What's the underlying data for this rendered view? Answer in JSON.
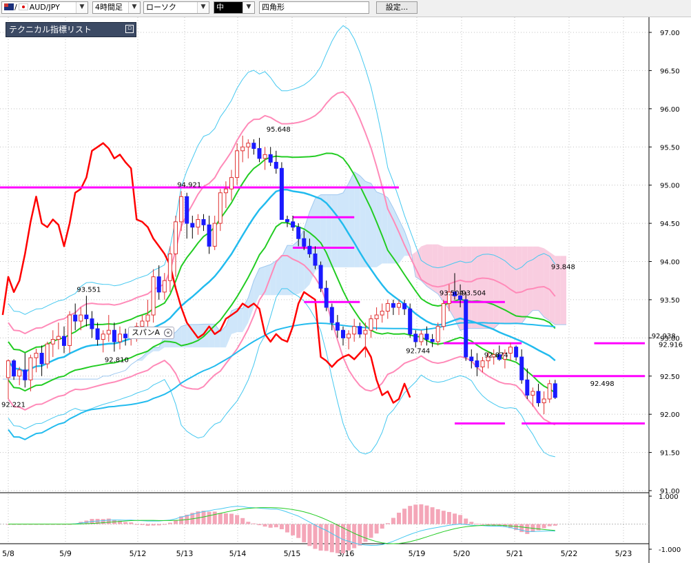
{
  "toolbar": {
    "pair": "AUD/JPY",
    "timeframe": "4時間足",
    "chart_style": "ローソク",
    "line_width": "中",
    "shape": "四角形",
    "settings_label": "設定..."
  },
  "indicator_panel": {
    "title": "テクニカル指標リスト",
    "minimize_icon": "minimize-icon"
  },
  "span_tag": {
    "label": "スパンA"
  },
  "colors": {
    "bull": "#e03030",
    "bear": "#1a1aff",
    "chikou": "#ff0000",
    "bb_mid": "#22cc22",
    "bb1": "#ff8ab8",
    "bb2": "#44c8f0",
    "ma": "#22bbee",
    "cloud_bull": "#cfe6fa",
    "cloud_bear": "#f9cde0",
    "hline": "#ff00ff"
  },
  "chart_data": {
    "type": "candlestick",
    "y_ticks": [
      "97.00",
      "96.50",
      "96.00",
      "95.50",
      "95.00",
      "94.50",
      "94.00",
      "93.50",
      "93.00",
      "92.50",
      "92.00",
      "91.50",
      "91.00"
    ],
    "ylim": [
      91.0,
      97.0
    ],
    "x_labels": [
      "5/8",
      "5/9",
      "5/12",
      "5/13",
      "5/14",
      "5/15",
      "5/16",
      "5/19",
      "5/20",
      "5/21",
      "5/22",
      "5/23"
    ],
    "current_price_label": "92.916",
    "annotations": [
      {
        "text": "93.551",
        "x": 14,
        "price": 93.551,
        "pos": "above"
      },
      {
        "text": "92.810",
        "x": 19,
        "price": 92.81,
        "pos": "below"
      },
      {
        "text": "94.921",
        "x": 32,
        "price": 94.921,
        "pos": "above"
      },
      {
        "text": "95.648",
        "x": 48,
        "price": 95.648,
        "pos": "above"
      },
      {
        "text": "92.744",
        "x": 73,
        "price": 92.744,
        "pos": "above"
      },
      {
        "text": "93.504",
        "x": 79,
        "price": 93.504,
        "pos": "above"
      },
      {
        "text": "93.504",
        "x": 83,
        "price": 93.504,
        "pos": "above"
      },
      {
        "text": "92.874",
        "x": 87,
        "price": 92.874,
        "pos": "below"
      },
      {
        "text": "93.848",
        "x": 99,
        "price": 93.848,
        "pos": "above"
      },
      {
        "text": "92.498",
        "x": 106,
        "price": 92.498,
        "pos": "below"
      },
      {
        "text": "92.938",
        "x": 117,
        "price": 92.938,
        "pos": "above"
      },
      {
        "text": "92.221",
        "x": 0,
        "price": 92.221,
        "pos": "below"
      }
    ],
    "ohlc": [
      [
        92.48,
        92.72,
        92.2,
        92.7
      ],
      [
        92.7,
        92.72,
        92.45,
        92.5
      ],
      [
        92.5,
        92.62,
        92.38,
        92.58
      ],
      [
        92.58,
        92.8,
        92.35,
        92.45
      ],
      [
        92.45,
        92.78,
        92.3,
        92.74
      ],
      [
        92.74,
        92.86,
        92.55,
        92.8
      ],
      [
        92.8,
        92.9,
        92.5,
        92.66
      ],
      [
        92.66,
        92.95,
        92.6,
        92.92
      ],
      [
        92.92,
        93.1,
        92.75,
        92.98
      ],
      [
        92.98,
        93.2,
        92.85,
        93.02
      ],
      [
        93.02,
        93.15,
        92.8,
        92.9
      ],
      [
        92.9,
        93.35,
        92.8,
        93.3
      ],
      [
        93.3,
        93.45,
        93.1,
        93.22
      ],
      [
        93.22,
        93.4,
        93.1,
        93.3
      ],
      [
        93.3,
        93.551,
        93.15,
        93.25
      ],
      [
        93.25,
        93.35,
        93.0,
        93.12
      ],
      [
        93.12,
        93.2,
        92.9,
        92.98
      ],
      [
        92.98,
        93.1,
        92.81,
        93.05
      ],
      [
        93.05,
        93.3,
        92.95,
        93.1
      ],
      [
        93.1,
        93.2,
        92.82,
        92.95
      ],
      [
        92.95,
        93.15,
        92.85,
        93.05
      ],
      [
        93.05,
        93.12,
        92.9,
        93.0
      ],
      [
        93.0,
        93.1,
        92.9,
        93.05
      ],
      [
        93.05,
        93.2,
        92.95,
        93.15
      ],
      [
        93.15,
        93.3,
        93.0,
        93.22
      ],
      [
        93.22,
        93.5,
        93.1,
        93.3
      ],
      [
        93.3,
        93.9,
        93.2,
        93.8
      ],
      [
        93.8,
        93.95,
        93.5,
        93.6
      ],
      [
        93.6,
        93.85,
        93.5,
        93.75
      ],
      [
        93.75,
        94.2,
        93.6,
        94.1
      ],
      [
        94.1,
        94.6,
        93.8,
        94.52
      ],
      [
        94.52,
        94.921,
        94.4,
        94.85
      ],
      [
        94.85,
        94.9,
        94.3,
        94.5
      ],
      [
        94.5,
        94.6,
        94.3,
        94.45
      ],
      [
        94.45,
        94.62,
        94.35,
        94.55
      ],
      [
        94.55,
        94.62,
        94.4,
        94.48
      ],
      [
        94.48,
        94.6,
        94.1,
        94.2
      ],
      [
        94.2,
        94.6,
        94.15,
        94.5
      ],
      [
        94.5,
        94.95,
        94.4,
        94.9
      ],
      [
        94.9,
        95.05,
        94.7,
        94.95
      ],
      [
        94.95,
        95.2,
        94.8,
        95.1
      ],
      [
        95.1,
        95.55,
        95.0,
        95.45
      ],
      [
        95.45,
        95.648,
        95.3,
        95.5
      ],
      [
        95.5,
        95.6,
        95.35,
        95.55
      ],
      [
        95.55,
        95.6,
        95.4,
        95.48
      ],
      [
        95.48,
        95.62,
        95.3,
        95.35
      ],
      [
        95.35,
        95.5,
        95.2,
        95.4
      ],
      [
        95.4,
        95.5,
        95.25,
        95.3
      ],
      [
        95.3,
        95.45,
        95.15,
        95.22
      ],
      [
        95.22,
        95.3,
        94.6,
        94.55
      ],
      [
        94.55,
        94.6,
        94.45,
        94.52
      ],
      [
        94.52,
        94.6,
        94.4,
        94.45
      ],
      [
        94.45,
        94.5,
        94.2,
        94.3
      ],
      [
        94.3,
        94.4,
        94.15,
        94.2
      ],
      [
        94.2,
        94.3,
        94.05,
        94.1
      ],
      [
        94.1,
        94.2,
        93.9,
        93.95
      ],
      [
        93.95,
        94.0,
        93.6,
        93.65
      ],
      [
        93.65,
        93.75,
        93.35,
        93.4
      ],
      [
        93.4,
        93.45,
        93.1,
        93.2
      ],
      [
        93.2,
        93.3,
        93.0,
        93.1
      ],
      [
        93.1,
        93.15,
        92.9,
        93.0
      ],
      [
        93.0,
        93.1,
        92.85,
        93.05
      ],
      [
        93.05,
        93.25,
        92.95,
        93.15
      ],
      [
        93.15,
        93.2,
        93.0,
        93.05
      ],
      [
        93.05,
        93.2,
        92.744,
        93.1
      ],
      [
        93.1,
        93.3,
        93.0,
        93.25
      ],
      [
        93.25,
        93.4,
        93.1,
        93.3
      ],
      [
        93.3,
        93.45,
        93.2,
        93.35
      ],
      [
        93.35,
        93.504,
        93.25,
        93.45
      ],
      [
        93.45,
        93.5,
        93.3,
        93.4
      ],
      [
        93.4,
        93.504,
        93.3,
        93.45
      ],
      [
        93.45,
        93.5,
        93.3,
        93.38
      ],
      [
        93.38,
        93.45,
        93.0,
        93.05
      ],
      [
        93.05,
        93.1,
        92.874,
        92.95
      ],
      [
        92.95,
        93.1,
        92.9,
        93.05
      ],
      [
        93.05,
        93.15,
        92.9,
        92.98
      ],
      [
        92.98,
        93.05,
        92.88,
        92.95
      ],
      [
        92.95,
        93.2,
        92.9,
        93.15
      ],
      [
        93.15,
        93.5,
        93.1,
        93.45
      ],
      [
        93.45,
        93.7,
        93.35,
        93.6
      ],
      [
        93.6,
        93.848,
        93.5,
        93.55
      ],
      [
        93.55,
        93.7,
        93.4,
        93.5
      ],
      [
        93.5,
        93.6,
        92.7,
        92.75
      ],
      [
        92.75,
        92.85,
        92.6,
        92.7
      ],
      [
        92.7,
        92.8,
        92.498,
        92.62
      ],
      [
        92.62,
        92.75,
        92.55,
        92.7
      ],
      [
        92.7,
        92.82,
        92.6,
        92.75
      ],
      [
        92.75,
        92.85,
        92.65,
        92.78
      ],
      [
        92.78,
        92.9,
        92.7,
        92.72
      ],
      [
        92.72,
        92.85,
        92.6,
        92.8
      ],
      [
        92.8,
        92.938,
        92.7,
        92.88
      ],
      [
        92.88,
        92.9,
        92.7,
        92.75
      ],
      [
        92.75,
        92.85,
        92.4,
        92.45
      ],
      [
        92.45,
        92.6,
        92.2,
        92.25
      ],
      [
        92.25,
        92.35,
        92.1,
        92.3
      ],
      [
        92.3,
        92.4,
        92.1,
        92.15
      ],
      [
        92.15,
        92.3,
        92.0,
        92.2
      ],
      [
        92.2,
        92.45,
        92.15,
        92.4
      ],
      [
        92.4,
        92.45,
        92.2,
        92.22
      ]
    ],
    "h_lines": [
      {
        "from": -5,
        "to": 70,
        "price": 94.97
      },
      {
        "from": 51,
        "to": 62,
        "price": 94.58
      },
      {
        "from": 51,
        "to": 62,
        "price": 94.18
      },
      {
        "from": 53,
        "to": 63,
        "price": 93.47
      },
      {
        "from": 78,
        "to": 89,
        "price": 93.47
      },
      {
        "from": 78,
        "to": 92,
        "price": 92.93
      },
      {
        "from": 94,
        "to": 118,
        "price": 92.5
      },
      {
        "from": 105,
        "to": 117,
        "price": 92.93
      },
      {
        "from": 80,
        "to": 89,
        "price": 91.88
      },
      {
        "from": 92,
        "to": 118,
        "price": 91.88
      }
    ],
    "osc_labels": [
      "1.000",
      "-1.000"
    ]
  }
}
